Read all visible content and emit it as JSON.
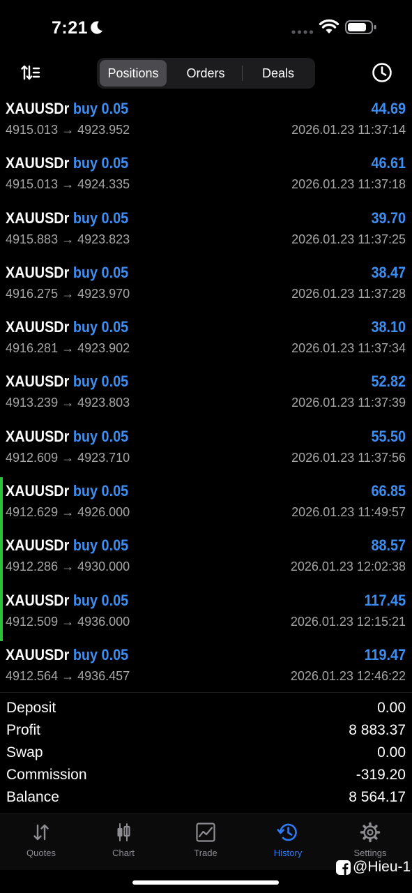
{
  "status": {
    "time": "7:21"
  },
  "toolbar": {
    "tabs": [
      {
        "label": "Positions",
        "selected": true
      },
      {
        "label": "Orders",
        "selected": false
      },
      {
        "label": "Deals",
        "selected": false
      }
    ]
  },
  "deals": [
    {
      "symbol": "XAUUSDr",
      "side": "buy",
      "volume": "0.05",
      "profit": "44.69",
      "open": "4915.013",
      "arrow": "→",
      "close": "4923.952",
      "time": "2026.01.23 11:37:14",
      "marked": false
    },
    {
      "symbol": "XAUUSDr",
      "side": "buy",
      "volume": "0.05",
      "profit": "46.61",
      "open": "4915.013",
      "arrow": "→",
      "close": "4924.335",
      "time": "2026.01.23 11:37:18",
      "marked": false
    },
    {
      "symbol": "XAUUSDr",
      "side": "buy",
      "volume": "0.05",
      "profit": "39.70",
      "open": "4915.883",
      "arrow": "→",
      "close": "4923.823",
      "time": "2026.01.23 11:37:25",
      "marked": false
    },
    {
      "symbol": "XAUUSDr",
      "side": "buy",
      "volume": "0.05",
      "profit": "38.47",
      "open": "4916.275",
      "arrow": "→",
      "close": "4923.970",
      "time": "2026.01.23 11:37:28",
      "marked": false
    },
    {
      "symbol": "XAUUSDr",
      "side": "buy",
      "volume": "0.05",
      "profit": "38.10",
      "open": "4916.281",
      "arrow": "→",
      "close": "4923.902",
      "time": "2026.01.23 11:37:34",
      "marked": false
    },
    {
      "symbol": "XAUUSDr",
      "side": "buy",
      "volume": "0.05",
      "profit": "52.82",
      "open": "4913.239",
      "arrow": "→",
      "close": "4923.803",
      "time": "2026.01.23 11:37:39",
      "marked": false
    },
    {
      "symbol": "XAUUSDr",
      "side": "buy",
      "volume": "0.05",
      "profit": "55.50",
      "open": "4912.609",
      "arrow": "→",
      "close": "4923.710",
      "time": "2026.01.23 11:37:56",
      "marked": false
    },
    {
      "symbol": "XAUUSDr",
      "side": "buy",
      "volume": "0.05",
      "profit": "66.85",
      "open": "4912.629",
      "arrow": "→",
      "close": "4926.000",
      "time": "2026.01.23 11:49:57",
      "marked": true
    },
    {
      "symbol": "XAUUSDr",
      "side": "buy",
      "volume": "0.05",
      "profit": "88.57",
      "open": "4912.286",
      "arrow": "→",
      "close": "4930.000",
      "time": "2026.01.23 12:02:38",
      "marked": true
    },
    {
      "symbol": "XAUUSDr",
      "side": "buy",
      "volume": "0.05",
      "profit": "117.45",
      "open": "4912.509",
      "arrow": "→",
      "close": "4936.000",
      "time": "2026.01.23 12:15:21",
      "marked": true
    },
    {
      "symbol": "XAUUSDr",
      "side": "buy",
      "volume": "0.05",
      "profit": "119.47",
      "open": "4912.564",
      "arrow": "→",
      "close": "4936.457",
      "time": "2026.01.23 12:46:22",
      "marked": false
    }
  ],
  "summary": [
    {
      "label": "Deposit",
      "value": "0.00"
    },
    {
      "label": "Profit",
      "value": "8 883.37"
    },
    {
      "label": "Swap",
      "value": "0.00"
    },
    {
      "label": "Commission",
      "value": "-319.20"
    },
    {
      "label": "Balance",
      "value": "8 564.17"
    }
  ],
  "tabbar": {
    "items": [
      {
        "label": "Quotes",
        "icon": "quotes-arrows-icon",
        "active": false
      },
      {
        "label": "Chart",
        "icon": "candlestick-icon",
        "active": false
      },
      {
        "label": "Trade",
        "icon": "trade-chart-icon",
        "active": false
      },
      {
        "label": "History",
        "icon": "history-clock-icon",
        "active": true
      },
      {
        "label": "Settings",
        "icon": "gear-icon",
        "active": false
      }
    ]
  },
  "watermark": {
    "text": "@Hieu-1"
  },
  "colors": {
    "accent": "#2f7bf5",
    "profit_blue": "#3d8ef2",
    "marker_green": "#2bbf3a",
    "muted": "#a6a6a6"
  }
}
